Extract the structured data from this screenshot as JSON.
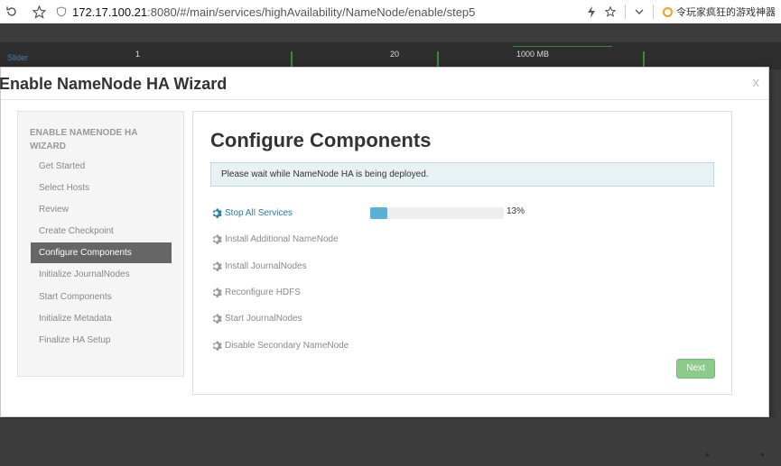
{
  "browser": {
    "url_host": "172.17.100.21",
    "url_path": ":8080/#/main/services/highAvailability/NameNode/enable/step5",
    "promo_text": "令玩家疯狂的游戏神器"
  },
  "background_page": {
    "slider_label": "Slider",
    "cells": [
      "1",
      "20",
      "1000 MB"
    ]
  },
  "modal": {
    "title": "Enable NameNode HA Wizard",
    "close_label": "x"
  },
  "sidebar": {
    "heading": "ENABLE NAMENODE HA WIZARD",
    "items": [
      {
        "label": "Get Started",
        "active": false
      },
      {
        "label": "Select Hosts",
        "active": false
      },
      {
        "label": "Review",
        "active": false
      },
      {
        "label": "Create Checkpoint",
        "active": false
      },
      {
        "label": "Configure Components",
        "active": true
      },
      {
        "label": "Initialize JournalNodes",
        "active": false
      },
      {
        "label": "Start Components",
        "active": false
      },
      {
        "label": "Initialize Metadata",
        "active": false
      },
      {
        "label": "Finalize HA Setup",
        "active": false
      }
    ]
  },
  "main": {
    "title": "Configure Components",
    "alert": "Please wait while NameNode HA is being deployed.",
    "tasks": [
      {
        "label": "Stop All Services",
        "status": "running"
      },
      {
        "label": "Install Additional NameNode",
        "status": "pending"
      },
      {
        "label": "Install JournalNodes",
        "status": "pending"
      },
      {
        "label": "Reconfigure HDFS",
        "status": "pending"
      },
      {
        "label": "Start JournalNodes",
        "status": "pending"
      },
      {
        "label": "Disable Secondary NameNode",
        "status": "pending"
      }
    ],
    "progress_percent": 13,
    "progress_text": "13%",
    "next_label": "Next"
  },
  "colors": {
    "active_item": "#666666",
    "running_task": "#2a7aaa",
    "progress_fill": "#5bb0d8",
    "next_button": "#8ccb8c"
  }
}
